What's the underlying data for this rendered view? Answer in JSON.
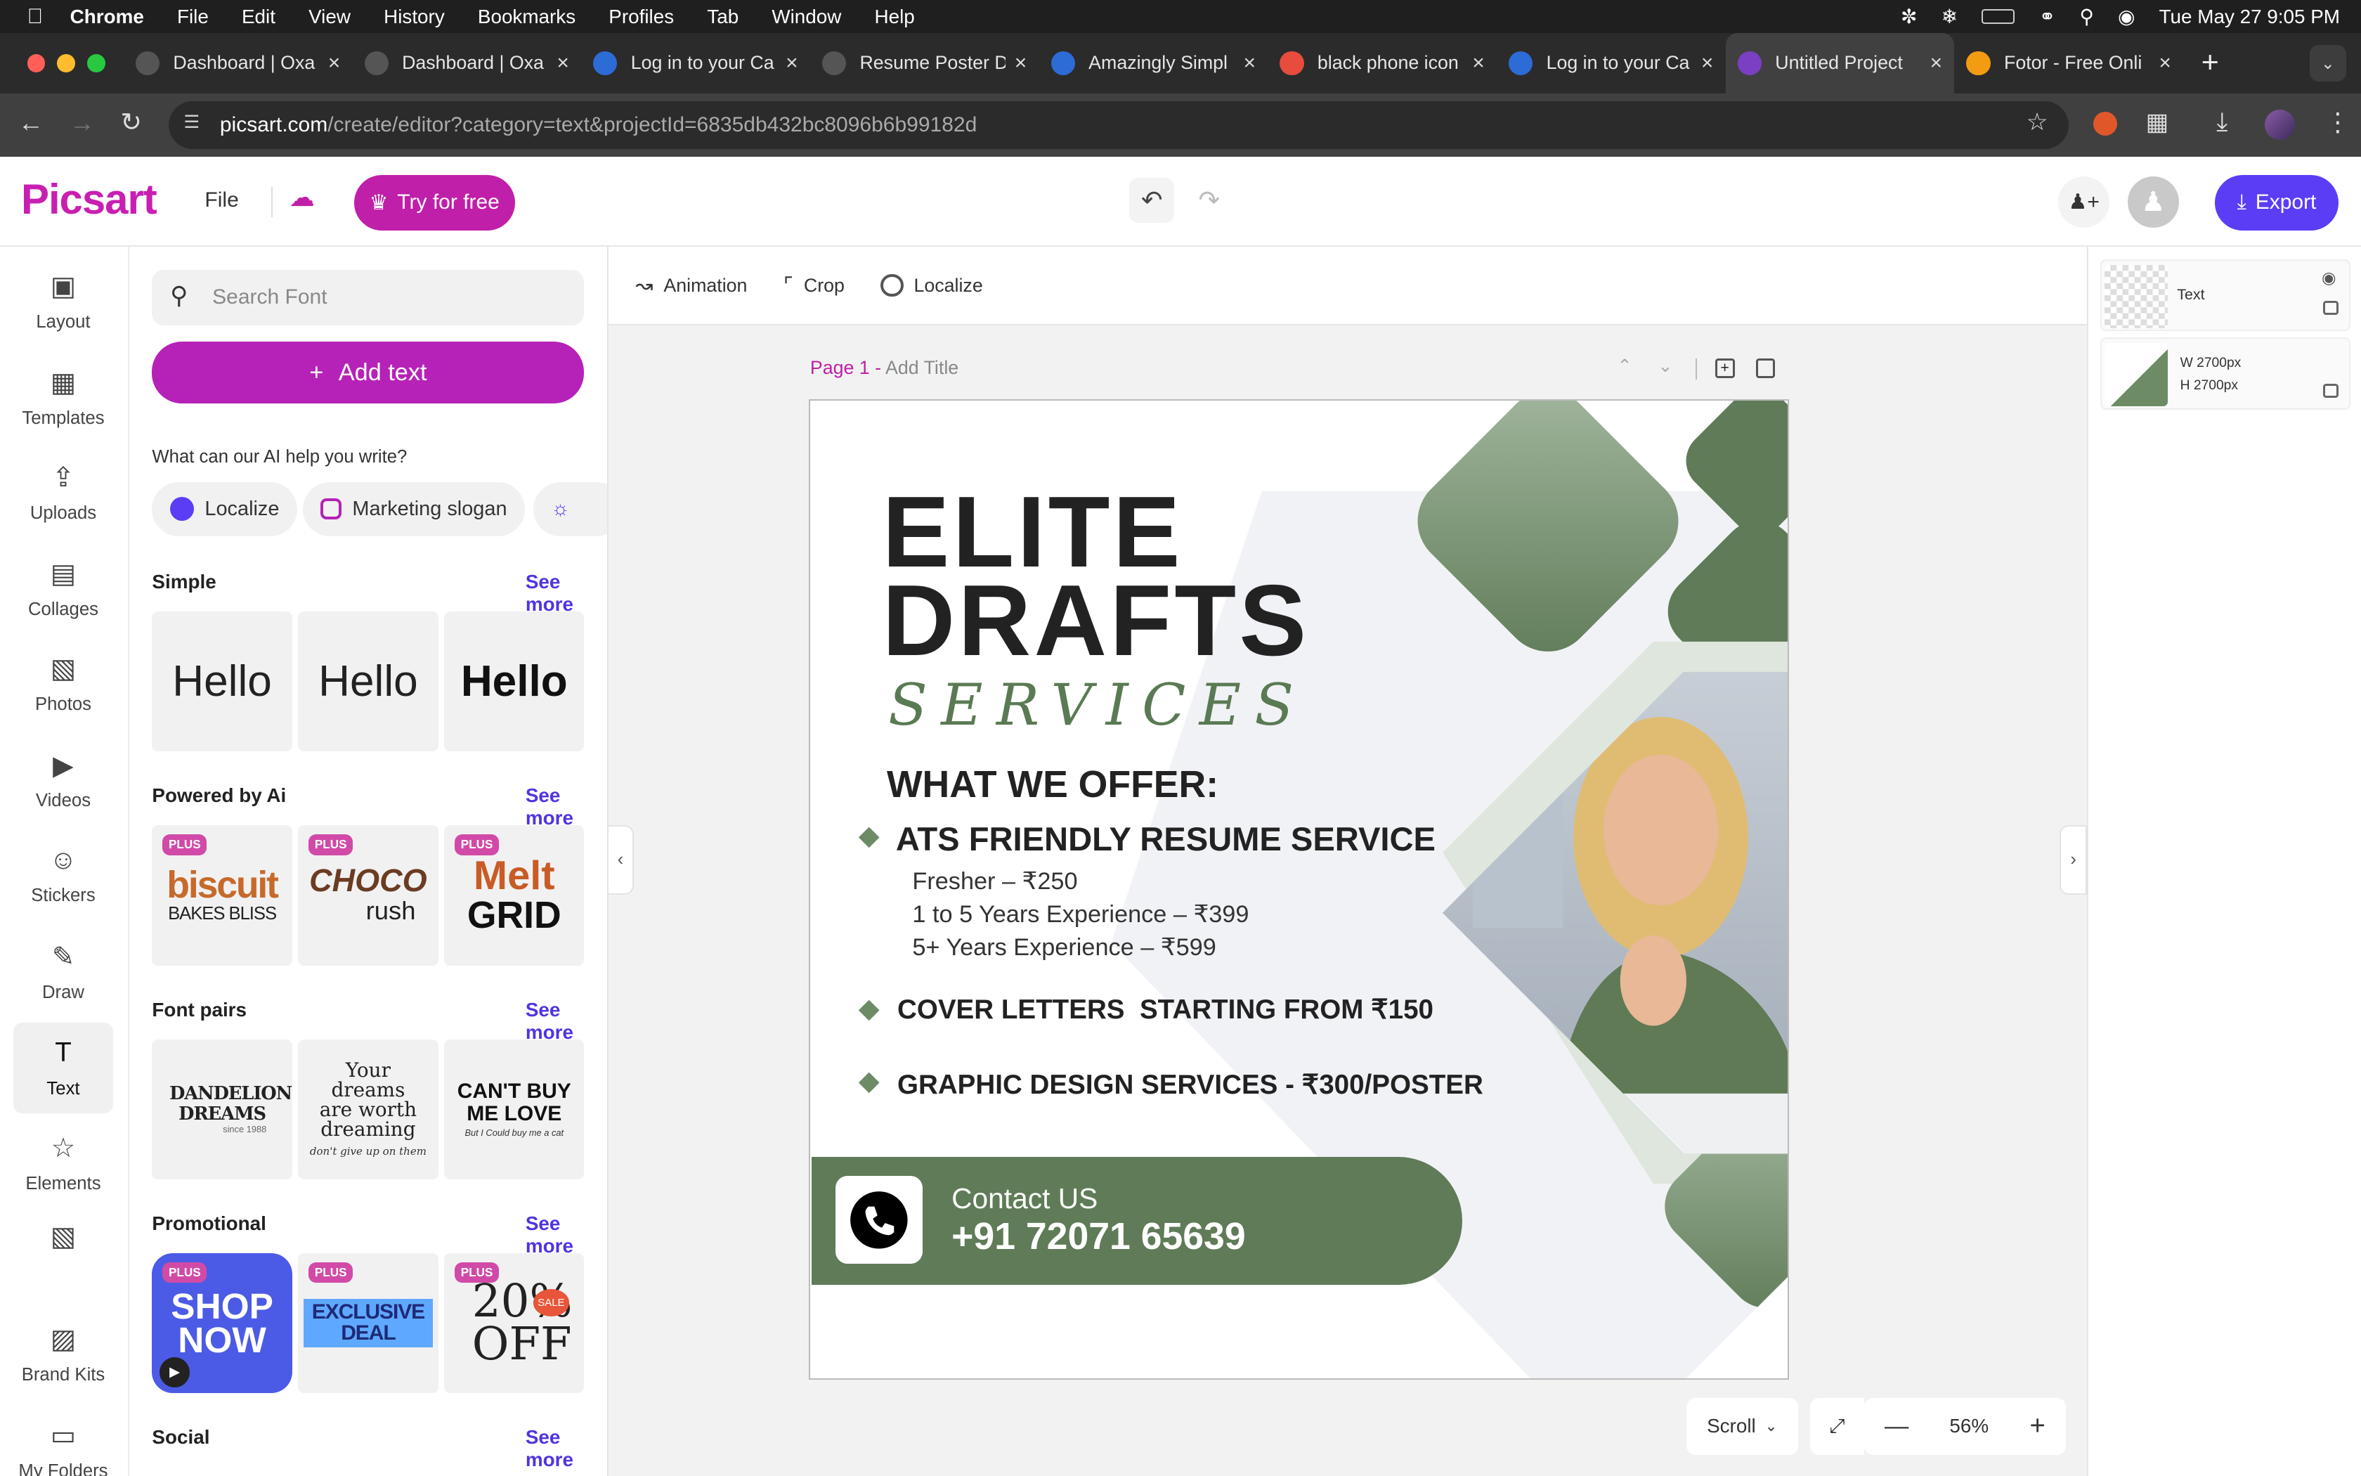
{
  "menubar": {
    "app": "Chrome",
    "items": [
      "File",
      "Edit",
      "View",
      "History",
      "Bookmarks",
      "Profiles",
      "Tab",
      "Window",
      "Help"
    ],
    "datetime": "Tue May 27  9:05 PM"
  },
  "tabs": [
    {
      "title": "Dashboard | Oxa",
      "color": "#555"
    },
    {
      "title": "Dashboard | Oxa",
      "color": "#555"
    },
    {
      "title": "Log in to your Ca",
      "color": "#2d6bd6"
    },
    {
      "title": "Resume Poster D",
      "color": "#555"
    },
    {
      "title": "Amazingly Simpl",
      "color": "#2d6bd6"
    },
    {
      "title": "black phone icon",
      "color": "#e74c3c"
    },
    {
      "title": "Log in to your Ca",
      "color": "#2d6bd6"
    },
    {
      "title": "Untitled Project",
      "color": "#7b3fc4",
      "active": true
    },
    {
      "title": "Fotor - Free Onli",
      "color": "#f39c12"
    }
  ],
  "address": {
    "host": "picsart.com",
    "path": "/create/editor?category=text&projectId=6835db432bc8096b6b99182d"
  },
  "header": {
    "logo": "Picsart",
    "file": "File",
    "try": "Try for free",
    "export": "Export"
  },
  "rail": [
    "Layout",
    "Templates",
    "Uploads",
    "Collages",
    "Photos",
    "Videos",
    "Stickers",
    "Draw",
    "Text",
    "Elements",
    "Brand Kits",
    "My Folders"
  ],
  "panel": {
    "search_placeholder": "Search Font",
    "add_text": "Add text",
    "ai_prompt": "What can our AI help you write?",
    "chips": [
      "Localize",
      "Marketing slogan"
    ],
    "see_more": "See more",
    "sections": [
      "Simple",
      "Powered by Ai",
      "Font pairs",
      "Promotional",
      "Social"
    ],
    "simple": [
      "Hello",
      "Hello",
      "Hello"
    ],
    "ai_cards": [
      {
        "a": "biscuit",
        "b": "BAKES BLISS"
      },
      {
        "a": "CHOCO",
        "b": "rush"
      },
      {
        "a": "Melt",
        "b": "GRID"
      }
    ],
    "font_pairs": [
      {
        "a": "DANDELION DREAMS",
        "b": "since 1988"
      },
      {
        "a": "Your dreams are worth dreaming",
        "b": "don't give up on them"
      },
      {
        "a": "CAN'T BUY ME LOVE",
        "b": "But I Could buy me a cat"
      }
    ],
    "promo": [
      {
        "a": "SHOP NOW"
      },
      {
        "a": "EXCLUSIVE DEAL"
      },
      {
        "a": "20% OFF",
        "b": "SALE"
      }
    ],
    "plus_badge": "PLUS"
  },
  "toolbar": {
    "animation": "Animation",
    "crop": "Crop",
    "localize": "Localize"
  },
  "page": {
    "label": "Page 1 -",
    "title_placeholder": "Add Title"
  },
  "poster": {
    "title1": "ELITE",
    "title2": "DRAFTS",
    "title3": "SERVICES",
    "offer_heading": "WHAT WE OFFER:",
    "s1": "ATS FRIENDLY RESUME SERVICE",
    "p1": "Fresher – ₹250",
    "p2": "1 to 5 Years Experience – ₹399",
    "p3": "5+ Years Experience – ₹599",
    "s2": "COVER LETTERS  STARTING FROM ₹150",
    "s3": "GRAPHIC DESIGN SERVICES - ₹300/POSTER",
    "contact_label": "Contact US",
    "phone": "+91 72071 65639",
    "green": "#5f7b57"
  },
  "zoom": {
    "mode": "Scroll",
    "level": "56%"
  },
  "layers": [
    {
      "name": "Text"
    },
    {
      "w": "W 2700px",
      "h": "H 2700px"
    }
  ],
  "colors": {
    "brand": "#c81fb2",
    "export": "#5b3df6",
    "accent": "#5134e0"
  }
}
